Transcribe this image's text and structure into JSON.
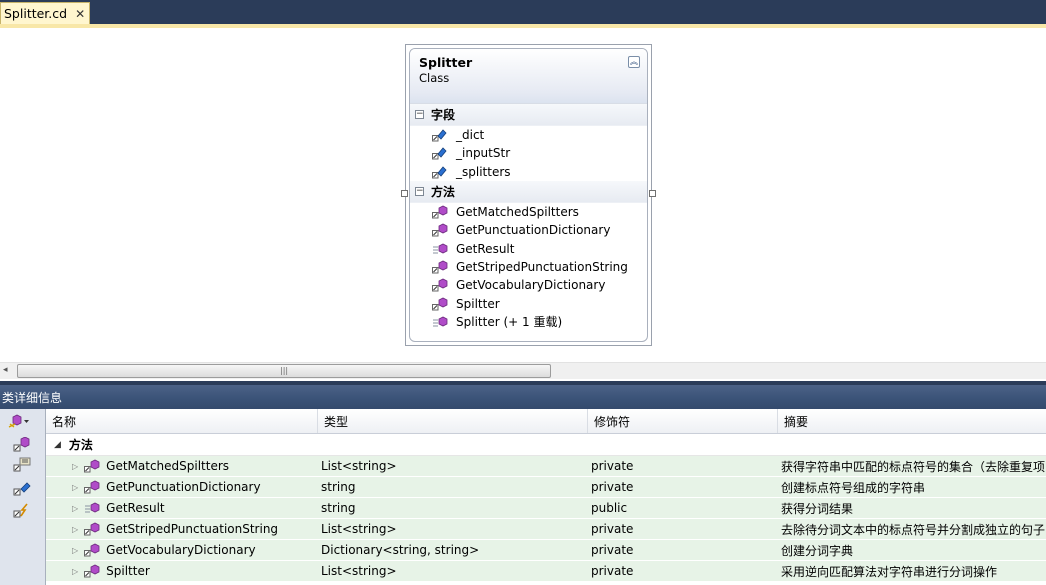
{
  "tab": {
    "title": "Splitter.cd",
    "close": "✕"
  },
  "class_shape": {
    "name": "Splitter",
    "kind": "Class",
    "collapse_glyph": "︽",
    "fields_title": "字段",
    "methods_title": "方法",
    "toggle_glyph": "−",
    "fields": [
      "_dict",
      "_inputStr",
      "_splitters"
    ],
    "methods": [
      "GetMatchedSpiltters",
      "GetPunctuationDictionary",
      "GetResult",
      "GetStripedPunctuationString",
      "GetVocabularyDictionary",
      "Spiltter",
      "Splitter (+ 1 重载)"
    ]
  },
  "scrollbar": {
    "left_arrow": "◂",
    "grip": "|||"
  },
  "details": {
    "title": "类详细信息",
    "columns": [
      "名称",
      "类型",
      "修饰符",
      "摘要"
    ],
    "group_label": "方法",
    "group_arrow": "◢",
    "row_arrow": "▷",
    "rows": [
      {
        "name": "GetMatchedSpiltters",
        "type": "List<string>",
        "modifier": "private",
        "summary": "获得字符串中匹配的标点符号的集合（去除重复项"
      },
      {
        "name": "GetPunctuationDictionary",
        "type": "string",
        "modifier": "private",
        "summary": "创建标点符号组成的字符串"
      },
      {
        "name": "GetResult",
        "type": "string",
        "modifier": "public",
        "summary": "获得分词结果"
      },
      {
        "name": "GetStripedPunctuationString",
        "type": "List<string>",
        "modifier": "private",
        "summary": "去除待分词文本中的标点符号并分割成独立的句子"
      },
      {
        "name": "GetVocabularyDictionary",
        "type": "Dictionary<string, string>",
        "modifier": "private",
        "summary": "创建分词字典"
      },
      {
        "name": "Spiltter",
        "type": "List<string>",
        "modifier": "private",
        "summary": "采用逆向匹配算法对字符串进行分词操作"
      }
    ]
  },
  "colors": {
    "tab_bg": "#fff6cf",
    "title_bar": "#3b5378",
    "row_highlight": "#e7f3e7",
    "method_icon": "#b04cc8",
    "field_icon": "#2a6fd0"
  }
}
